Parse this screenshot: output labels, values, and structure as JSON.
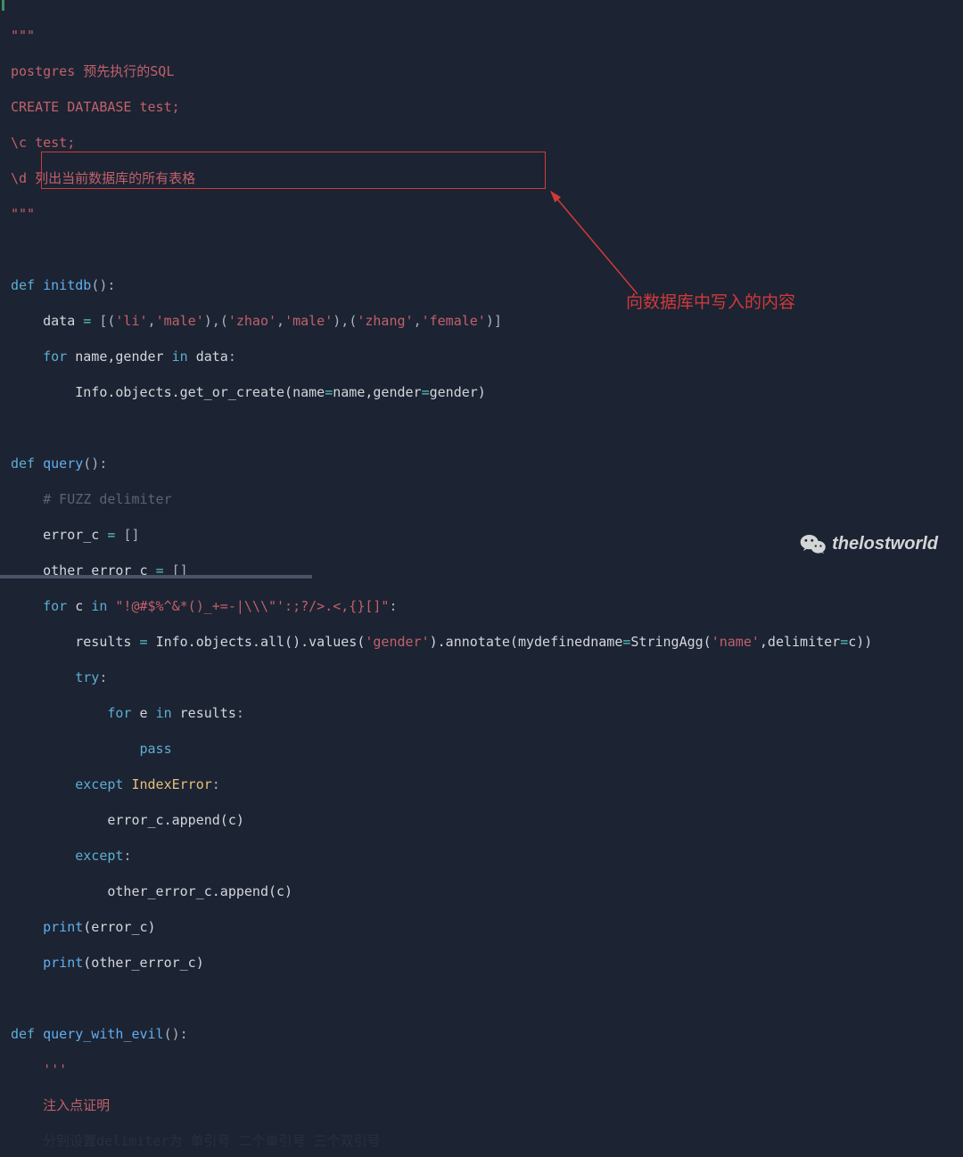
{
  "docstring": {
    "open": "\"\"\"",
    "l1": "postgres 预先执行的SQL",
    "l2": "CREATE DATABASE test;",
    "l3": "\\c test;",
    "l4": "\\d 列出当前数据库的所有表格",
    "close": "\"\"\""
  },
  "func1": {
    "def": "def ",
    "name": "initdb",
    "sig": "():",
    "data_assign": "data ",
    "eq": "= ",
    "data_list": "[('li','male'),('zhao','male'),('zhang','female')]",
    "lb": "[",
    "rb": "]",
    "lp": "(",
    "rp": ")",
    "c": ",",
    "s_li": "'li'",
    "s_male": "'male'",
    "s_zhao": "'zhao'",
    "s_zhang": "'zhang'",
    "s_female": "'female'",
    "for": "for ",
    "iter": "name,gender ",
    "in": "in ",
    "data": "data",
    "colon": ":",
    "body": "Info.objects.get_or_create(name",
    "body_mid": "name,gender",
    "body_end": "gender)"
  },
  "func2": {
    "def": "def ",
    "name": "query",
    "sig": "():",
    "cmt": "# FUZZ delimiter",
    "a1": "error_c ",
    "eq": "= ",
    "empty": "[]",
    "a2": "other_error_c ",
    "for": "for ",
    "c": "c ",
    "in": "in ",
    "fuzz": "\"!@#$%^&*()_+=-|\\\\\\\"':;?/>.<,{}[]\"",
    "colon": ":",
    "res": "results ",
    "call_a": "Info.objects.all().values(",
    "s_gender": "'gender'",
    "call_b": ").annotate(mydefinedname",
    "call_c": "StringAgg(",
    "s_name": "'name'",
    "call_d": ",delimiter",
    "call_e": "c))",
    "try": "try",
    "for2": "for ",
    "e": "e ",
    "in2": "in ",
    "results": "results",
    "pass": "pass",
    "except": "except ",
    "IndexError": "IndexError",
    "append1": "error_c.append(c)",
    "except2": "except",
    "append2": "other_error_c.append(c)",
    "print": "print",
    "p1": "(error_c)",
    "p2": "(other_error_c)"
  },
  "func3": {
    "def": "def ",
    "name": "query_with_evil",
    "sig": "():",
    "tdq": "'''",
    "l1": "注入点证明",
    "l2": "分别设置delimiter为 单引号 二个单引号 三个双引号"
  },
  "annotation": "向数据库中写入的内容",
  "watermark": "thelostworld"
}
